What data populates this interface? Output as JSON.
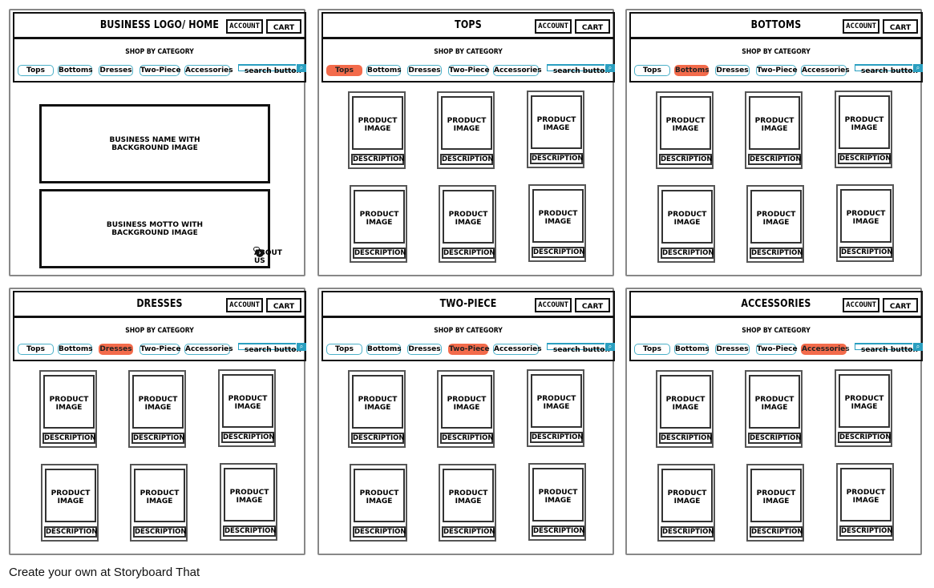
{
  "common": {
    "account_label": "ACCOUNT",
    "cart_label": "CART",
    "shop_by_category": "SHOP BY CATEGORY",
    "categories": [
      "Tops",
      "Bottoms",
      "Dresses",
      "Two-Piece",
      "Accessories"
    ],
    "search_label": "search button",
    "search_icon": "magnifier",
    "product_image_label": "PRODUCT IMAGE",
    "description_label": "DESCRIPTION",
    "active_color": "#f36b4b",
    "category_border_color": "#4bb0c8"
  },
  "panels": [
    {
      "title": "BUSINESS LOGO/ HOME",
      "active": -1,
      "type": "home",
      "hero_name": "BUSINESS NAME WITH BACKGROUND IMAGE",
      "hero_motto": "BUSINESS MOTTO WITH BACKGROUND IMAGE",
      "about_label": "ABOUT US"
    },
    {
      "title": "TOPS",
      "active": 0,
      "type": "grid"
    },
    {
      "title": "BOTTOMS",
      "active": 1,
      "type": "grid"
    },
    {
      "title": "DRESSES",
      "active": 2,
      "type": "grid"
    },
    {
      "title": "TWO-PIECE",
      "active": 3,
      "type": "grid"
    },
    {
      "title": "ACCESSORIES",
      "active": 4,
      "type": "grid"
    }
  ],
  "footer": "Create your own at Storyboard That"
}
